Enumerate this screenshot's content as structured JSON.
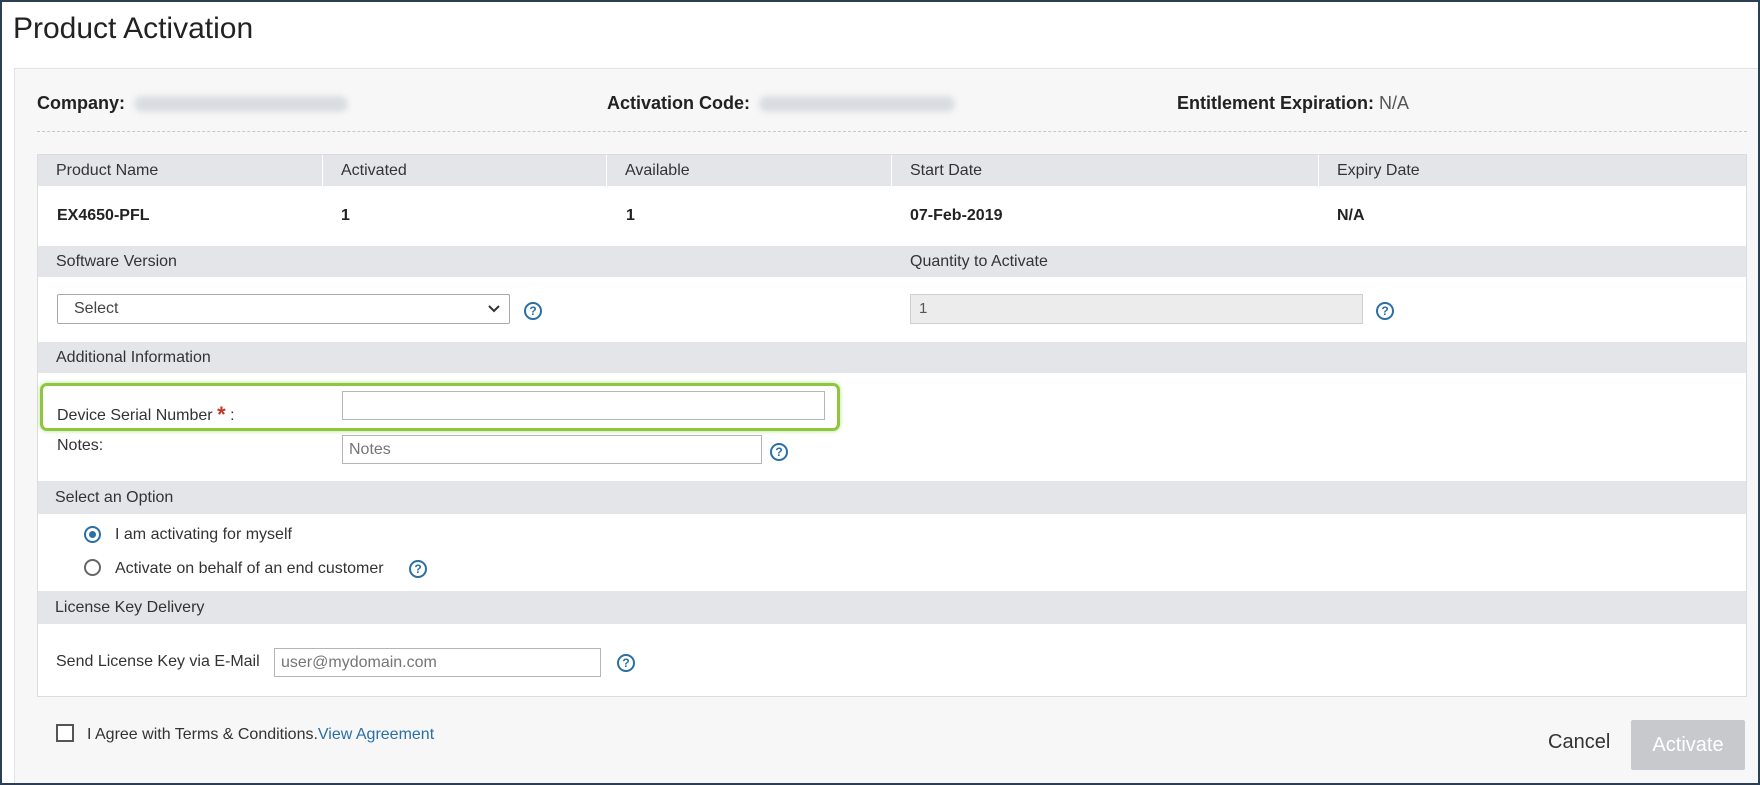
{
  "page": {
    "title": "Product Activation"
  },
  "info": {
    "company_label": "Company:",
    "activation_code_label": "Activation Code:",
    "entitlement_label": "Entitlement Expiration:",
    "entitlement_value": "N/A"
  },
  "product_table": {
    "headers": [
      "Product Name",
      "Activated",
      "Available",
      "Start Date",
      "Expiry Date"
    ],
    "row": [
      "EX4650-PFL",
      "1",
      "1",
      "07-Feb-2019",
      "N/A"
    ]
  },
  "software": {
    "version_label": "Software Version",
    "quantity_label": "Quantity to Activate",
    "version_select_value": "Select",
    "quantity_value": "1"
  },
  "additional": {
    "section_label": "Additional Information",
    "serial_label": "Device Serial Number",
    "serial_required_mark": "*",
    "serial_colon": ":",
    "serial_value": "",
    "notes_label": "Notes:",
    "notes_placeholder": "Notes"
  },
  "option": {
    "section_label": "Select an Option",
    "choices": [
      "I am activating for myself",
      "Activate on behalf of an end customer"
    ],
    "selected_index": 0
  },
  "license": {
    "section_label": "License Key Delivery",
    "email_label": "Send License Key via E-Mail",
    "email_placeholder": "user@mydomain.com"
  },
  "footer": {
    "terms_text": "I Agree with Terms & Conditions.",
    "terms_link": "View Agreement",
    "cancel_label": "Cancel",
    "activate_label": "Activate"
  },
  "icons": {
    "help": "help-circle-icon",
    "dropdown": "chevron-down-icon"
  },
  "colors": {
    "accent": "#2a6fa5",
    "highlight": "#8dc63f",
    "required": "#c0392b",
    "disabled_button": "#c7c9cc"
  }
}
